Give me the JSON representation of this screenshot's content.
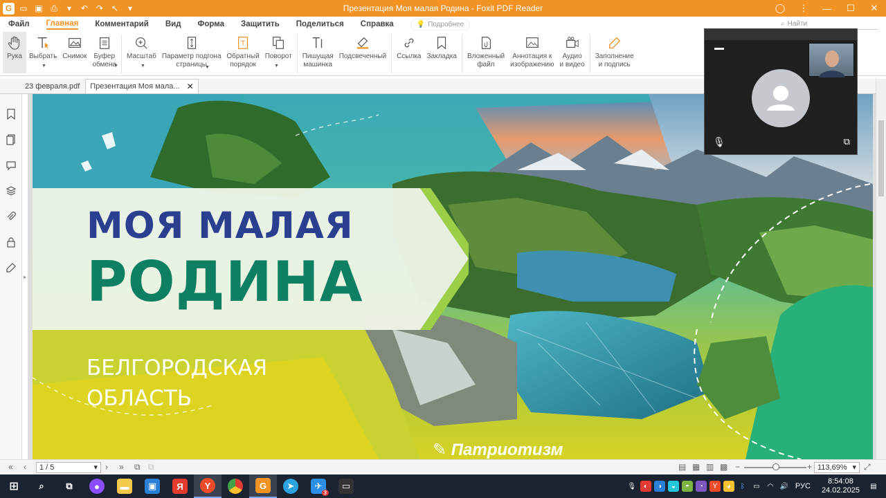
{
  "window": {
    "title": "Презентация Моя малая Родина - Foxit PDF Reader",
    "logo_letter": "G"
  },
  "menu": {
    "items": [
      "Файл",
      "Главная",
      "Комментарий",
      "Вид",
      "Форма",
      "Защитить",
      "Поделиться",
      "Справка"
    ],
    "tell_me": "Подробнее",
    "search_placeholder": "Найти"
  },
  "ribbon": {
    "hand": "Рука",
    "select": "Выбрать",
    "snapshot": "Снимок",
    "clipboard_1": "Буфер",
    "clipboard_2": "обмена",
    "zoom": "Масштаб",
    "pagefit_1": "Параметр подгона",
    "pagefit_2": "страницы",
    "reverse_1": "Обратный",
    "reverse_2": "порядок",
    "rotate": "Поворот",
    "typewriter_1": "Пишущая",
    "typewriter_2": "машинка",
    "highlight": "Подсвеченный",
    "link": "Ссылка",
    "bookmark": "Закладка",
    "attach_1": "Вложенный",
    "attach_2": "файл",
    "image_annot_1": "Аннотация к",
    "image_annot_2": "изображению",
    "audio_1": "Аудио",
    "audio_2": "и видео",
    "fill_1": "Заполнение",
    "fill_2": "и подпись"
  },
  "tabs": [
    {
      "label": "23 февраля.pdf"
    },
    {
      "label": "Презентация Моя мала..."
    }
  ],
  "slide": {
    "title_line1": "МОЯ МАЛАЯ",
    "title_line2": "РОДИНА",
    "region_line1": "БЕЛГОРОДСКАЯ",
    "region_line2": "ОБЛАСТЬ",
    "footer_tag": "Патриотизм"
  },
  "status": {
    "page": "1 / 5",
    "zoom": "113,69%"
  },
  "taskbar": {
    "lang": "РУС",
    "time": "8:54:08",
    "date": "24.02.2025",
    "telegram_badge": "3"
  },
  "colors": {
    "accent": "#f39323",
    "title_blue": "#2a3f8f",
    "title_green": "#0f7f62"
  }
}
